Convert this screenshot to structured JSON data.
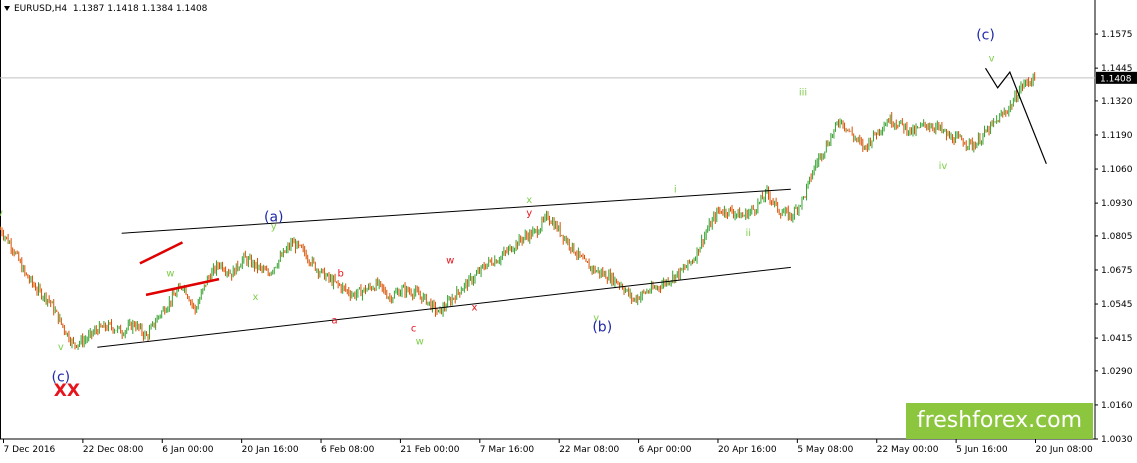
{
  "header": {
    "symbol": "EURUSD,H4",
    "ohlc": "1.1387 1.1418 1.1384 1.1408"
  },
  "watermark": "freshforex.com",
  "chart_data": {
    "type": "candlestick",
    "symbol": "EURUSD",
    "timeframe": "H4",
    "current_price": "1.1408",
    "ylim": [
      1.003,
      1.1705
    ],
    "y_ticks": [
      "1.1575",
      "1.1445",
      "1.1320",
      "1.1190",
      "1.1060",
      "1.0930",
      "1.0805",
      "1.0675",
      "1.0545",
      "1.0415",
      "1.0290",
      "1.0160",
      "1.0030"
    ],
    "x_ticks": [
      "7 Dec 2016",
      "22 Dec 08:00",
      "6 Jan 00:00",
      "20 Jan 16:00",
      "6 Feb 08:00",
      "21 Feb 00:00",
      "7 Mar 16:00",
      "22 Mar 08:00",
      "6 Apr 00:00",
      "20 Apr 16:00",
      "5 May 08:00",
      "22 May 00:00",
      "5 Jun 16:00",
      "20 Jun 08:00"
    ],
    "price_path": [
      [
        0,
        1.083
      ],
      [
        2,
        1.076
      ],
      [
        4,
        1.066
      ],
      [
        6,
        1.06
      ],
      [
        8,
        1.056
      ],
      [
        10,
        1.047
      ],
      [
        12,
        1.039
      ],
      [
        14,
        1.041
      ],
      [
        16,
        1.045
      ],
      [
        18,
        1.046
      ],
      [
        20,
        1.044
      ],
      [
        22,
        1.047
      ],
      [
        24,
        1.042
      ],
      [
        26,
        1.05
      ],
      [
        28,
        1.056
      ],
      [
        30,
        1.062
      ],
      [
        32,
        1.052
      ],
      [
        34,
        1.064
      ],
      [
        36,
        1.07
      ],
      [
        38,
        1.066
      ],
      [
        40,
        1.072
      ],
      [
        42,
        1.069
      ],
      [
        44,
        1.066
      ],
      [
        46,
        1.072
      ],
      [
        48,
        1.078
      ],
      [
        50,
        1.074
      ],
      [
        52,
        1.068
      ],
      [
        54,
        1.064
      ],
      [
        56,
        1.061
      ],
      [
        58,
        1.058
      ],
      [
        60,
        1.06
      ],
      [
        62,
        1.062
      ],
      [
        64,
        1.057
      ],
      [
        66,
        1.06
      ],
      [
        68,
        1.059
      ],
      [
        70,
        1.056
      ],
      [
        72,
        1.051
      ],
      [
        74,
        1.056
      ],
      [
        76,
        1.061
      ],
      [
        78,
        1.065
      ],
      [
        80,
        1.07
      ],
      [
        82,
        1.072
      ],
      [
        84,
        1.076
      ],
      [
        86,
        1.08
      ],
      [
        88,
        1.082
      ],
      [
        90,
        1.088
      ],
      [
        92,
        1.082
      ],
      [
        94,
        1.076
      ],
      [
        96,
        1.07
      ],
      [
        98,
        1.067
      ],
      [
        100,
        1.065
      ],
      [
        102,
        1.062
      ],
      [
        104,
        1.056
      ],
      [
        106,
        1.059
      ],
      [
        108,
        1.061
      ],
      [
        110,
        1.064
      ],
      [
        112,
        1.067
      ],
      [
        114,
        1.072
      ],
      [
        116,
        1.082
      ],
      [
        118,
        1.09
      ],
      [
        120,
        1.09
      ],
      [
        122,
        1.088
      ],
      [
        124,
        1.091
      ],
      [
        126,
        1.097
      ],
      [
        128,
        1.09
      ],
      [
        130,
        1.088
      ],
      [
        132,
        1.095
      ],
      [
        134,
        1.108
      ],
      [
        136,
        1.116
      ],
      [
        138,
        1.125
      ],
      [
        140,
        1.119
      ],
      [
        142,
        1.114
      ],
      [
        144,
        1.12
      ],
      [
        146,
        1.125
      ],
      [
        148,
        1.123
      ],
      [
        150,
        1.12
      ],
      [
        152,
        1.123
      ],
      [
        154,
        1.122
      ],
      [
        156,
        1.118
      ],
      [
        158,
        1.117
      ],
      [
        160,
        1.115
      ],
      [
        162,
        1.12
      ],
      [
        164,
        1.125
      ],
      [
        166,
        1.13
      ],
      [
        168,
        1.138
      ],
      [
        170,
        1.1408
      ]
    ],
    "trend_lines": [
      {
        "name": "upper-channel",
        "points": [
          [
            20,
            1.0815
          ],
          [
            130,
            1.0983
          ]
        ]
      },
      {
        "name": "lower-channel",
        "points": [
          [
            16,
            1.038
          ],
          [
            130,
            1.0685
          ]
        ]
      },
      {
        "name": "triangle-upper",
        "points": [
          [
            23,
            1.07
          ],
          [
            30,
            1.078
          ]
        ]
      },
      {
        "name": "triangle-lower",
        "points": [
          [
            24,
            1.058
          ],
          [
            36,
            1.064
          ]
        ]
      }
    ],
    "projection": [
      [
        162,
        1.1445
      ],
      [
        164,
        1.137
      ],
      [
        166,
        1.143
      ],
      [
        172,
        1.108
      ]
    ],
    "wave_labels": [
      {
        "text": "v",
        "x": 0,
        "y": 1.088,
        "color": "#7fce4a"
      },
      {
        "text": "v",
        "x": 10,
        "y": 1.037,
        "color": "#7fce4a"
      },
      {
        "text": "(c)",
        "x": 10,
        "y": 1.025,
        "color": "#1f2aa8"
      },
      {
        "text": "XX",
        "x": 11,
        "y": 1.0195,
        "color": "#e8141c"
      },
      {
        "text": "w",
        "x": 28,
        "y": 1.065,
        "color": "#7fce4a"
      },
      {
        "text": "x",
        "x": 42,
        "y": 1.056,
        "color": "#7fce4a"
      },
      {
        "text": "(a)",
        "x": 45,
        "y": 1.086,
        "color": "#1f2aa8"
      },
      {
        "text": "y",
        "x": 45,
        "y": 1.083,
        "color": "#7fce4a"
      },
      {
        "text": "a",
        "x": 55,
        "y": 1.047,
        "color": "#e8141c"
      },
      {
        "text": "b",
        "x": 56,
        "y": 1.065,
        "color": "#e8141c"
      },
      {
        "text": "c",
        "x": 68,
        "y": 1.044,
        "color": "#e8141c"
      },
      {
        "text": "w",
        "x": 69,
        "y": 1.039,
        "color": "#7fce4a"
      },
      {
        "text": "w",
        "x": 74,
        "y": 1.07,
        "color": "#e8141c"
      },
      {
        "text": "x",
        "x": 78,
        "y": 1.052,
        "color": "#e8141c"
      },
      {
        "text": "x",
        "x": 87,
        "y": 1.093,
        "color": "#7fce4a"
      },
      {
        "text": "y",
        "x": 87,
        "y": 1.088,
        "color": "#e8141c"
      },
      {
        "text": "y",
        "x": 98,
        "y": 1.048,
        "color": "#7fce4a"
      },
      {
        "text": "(b)",
        "x": 99,
        "y": 1.044,
        "color": "#1f2aa8"
      },
      {
        "text": "i",
        "x": 111,
        "y": 1.097,
        "color": "#7fce4a"
      },
      {
        "text": "ii",
        "x": 123,
        "y": 1.0805,
        "color": "#7fce4a"
      },
      {
        "text": "iii",
        "x": 132,
        "y": 1.134,
        "color": "#7fce4a"
      },
      {
        "text": "iv",
        "x": 155,
        "y": 1.106,
        "color": "#7fce4a"
      },
      {
        "text": "v",
        "x": 163,
        "y": 1.147,
        "color": "#7fce4a"
      },
      {
        "text": "(c)",
        "x": 162,
        "y": 1.1555,
        "color": "#1f2aa8"
      }
    ]
  }
}
